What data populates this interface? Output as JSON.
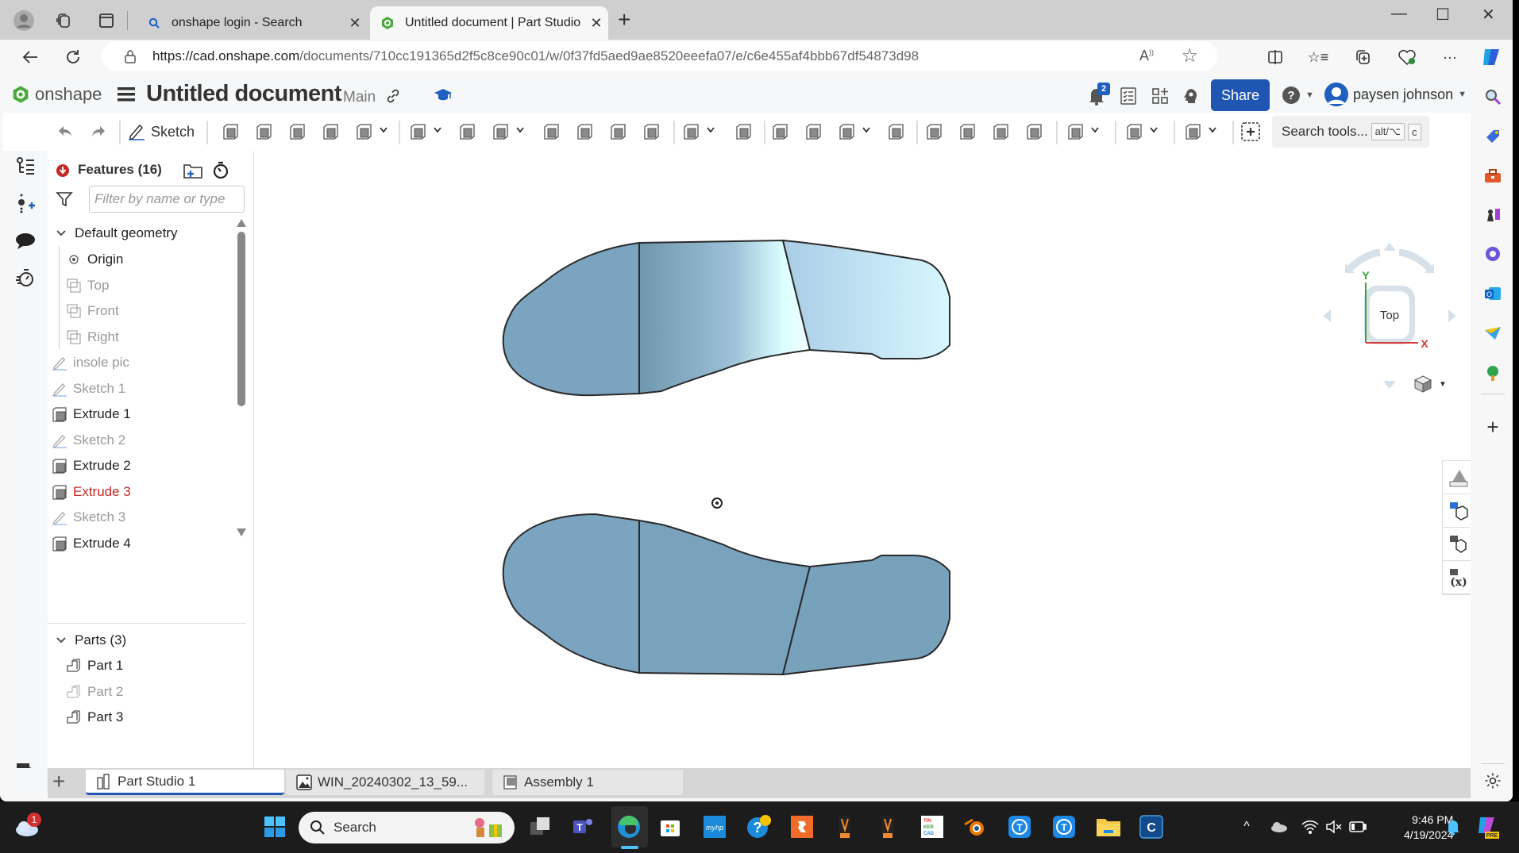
{
  "browser": {
    "tabs": [
      {
        "title": "onshape login - Search",
        "icon": "search-icon",
        "active": false
      },
      {
        "title": "Untitled document | Part Studio 1",
        "icon": "onshape-logo-icon",
        "active": true
      }
    ],
    "new_tab_label": "+",
    "url_host": "https://cad.onshape.com",
    "url_path": "/documents/710cc191365d2f5c8ce90c01/w/0f37fd5aed9ae8520eeefa07/e/c6e455af4bbb67df54873d98",
    "window_controls": [
      "minimize",
      "maximize",
      "close"
    ]
  },
  "app": {
    "brand": "onshape",
    "document_title": "Untitled document",
    "branch": "Main",
    "notifications_count": "2",
    "share_label": "Share",
    "user_name": "paysen johnson",
    "toolbar": {
      "sketch_label": "Sketch",
      "search_placeholder": "Search tools...",
      "search_shortcut_1": "alt/⌥",
      "search_shortcut_2": "c"
    },
    "feature_panel": {
      "title": "Features (16)",
      "filter_placeholder": "Filter by name or type",
      "default_geometry_label": "Default geometry",
      "default_geometry": [
        {
          "label": "Origin",
          "icon": "origin-icon",
          "state": "normal"
        },
        {
          "label": "Top",
          "icon": "plane-icon",
          "state": "muted"
        },
        {
          "label": "Front",
          "icon": "plane-icon",
          "state": "muted"
        },
        {
          "label": "Right",
          "icon": "plane-icon",
          "state": "muted"
        }
      ],
      "features": [
        {
          "label": "insole pic",
          "icon": "sketch-icon",
          "state": "muted"
        },
        {
          "label": "Sketch 1",
          "icon": "sketch-icon",
          "state": "muted"
        },
        {
          "label": "Extrude 1",
          "icon": "extrude-icon",
          "state": "normal"
        },
        {
          "label": "Sketch 2",
          "icon": "sketch-icon",
          "state": "muted"
        },
        {
          "label": "Extrude 2",
          "icon": "extrude-icon",
          "state": "normal"
        },
        {
          "label": "Extrude 3",
          "icon": "extrude-icon",
          "state": "error"
        },
        {
          "label": "Sketch 3",
          "icon": "sketch-icon",
          "state": "muted"
        },
        {
          "label": "Extrude 4",
          "icon": "extrude-icon",
          "state": "normal"
        }
      ],
      "parts_label": "Parts (3)",
      "parts": [
        {
          "label": "Part 1",
          "state": "normal"
        },
        {
          "label": "Part 2",
          "state": "muted"
        },
        {
          "label": "Part 3",
          "state": "normal"
        }
      ]
    },
    "viewcube": {
      "face_label": "Top",
      "x_label": "X",
      "y_label": "Y"
    },
    "bottom_tabs": [
      {
        "label": "Part Studio 1",
        "icon": "part-studio-icon",
        "active": true
      },
      {
        "label": "WIN_20240302_13_59...",
        "icon": "image-icon",
        "active": false
      },
      {
        "label": "Assembly 1",
        "icon": "assembly-icon",
        "active": false
      }
    ],
    "colors": {
      "accent": "#1f55b3",
      "part_fill": "#7aa4bf",
      "error": "#c62828"
    }
  },
  "taskbar": {
    "weather_badge": "1",
    "search_label": "Search",
    "time": "9:46 PM",
    "date": "4/19/2024"
  }
}
